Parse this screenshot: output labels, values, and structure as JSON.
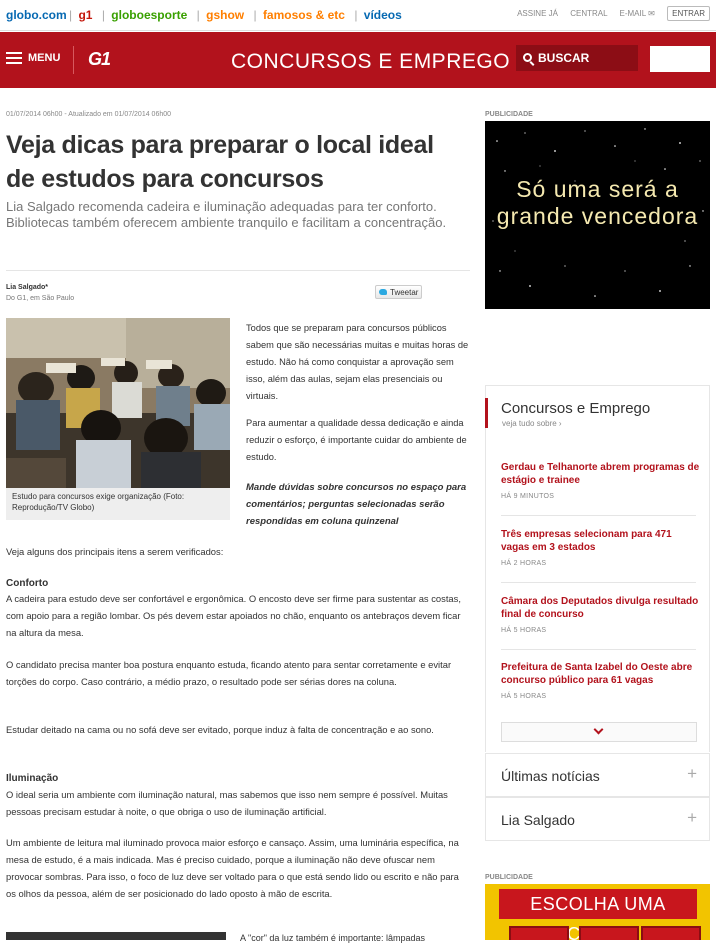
{
  "topbar": {
    "logo": "globo.com",
    "sites": [
      {
        "label": "g1",
        "color": "#c4170c"
      },
      {
        "label": "globoesporte",
        "color": "#39a000"
      },
      {
        "label": "gshow",
        "color": "#ff7f00"
      },
      {
        "label": "famosos & etc",
        "color": "#ff7f00"
      },
      {
        "label": "vídeos",
        "color": "#0669b2"
      }
    ],
    "assine": "ASSINE JÁ",
    "central": "CENTRAL",
    "email": "E-MAIL",
    "entrar": "ENTRAR"
  },
  "header": {
    "menu_label": "MENU",
    "logo": "G1",
    "section_title": "CONCURSOS E EMPREGO",
    "search_label": "BUSCAR"
  },
  "article": {
    "date": "01/07/2014 06h00 - Atualizado em 01/07/2014 06h00",
    "headline": "Veja dicas para preparar o local ideal de estudos para concursos",
    "subhead": "Lia Salgado recomenda cadeira e iluminação adequadas para ter conforto. Bibliotecas também oferecem ambiente tranquilo e facilitam a concentração.",
    "author": "Lia Salgado*",
    "author_location": "Do G1, em São Paulo",
    "tweet_label": "Tweetar",
    "photo_caption": "Estudo para concursos exige organização (Foto: Reprodução/TV Globo)",
    "intro_p1": "Todos que se preparam para concursos públicos sabem que são necessárias muitas e muitas horas de estudo. Não há como conquistar a aprovação sem isso, além das aulas, sejam elas presenciais ou virtuais.",
    "intro_p2": "Para aumentar a qualidade dessa dedicação e ainda reduzir o esforço, é importante cuidar do ambiente de estudo.",
    "intro_p3": "Mande dúvidas sobre concursos no espaço para comentários; perguntas selecionadas serão respondidas em coluna quinzenal",
    "body_1": "Veja alguns dos principais itens a serem verificados:",
    "heading_conforto": "Conforto",
    "body_2": "A cadeira para estudo deve ser confortável e ergonômica. O encosto deve ser firme para sustentar as costas, com apoio para a região lombar. Os pés devem estar apoiados no chão, enquanto os antebraços devem ficar na altura da mesa.",
    "body_3": "O candidato precisa manter boa postura enquanto estuda, ficando atento para sentar corretamente e evitar torções do corpo. Caso contrário, a médio prazo, o resultado pode ser sérias dores na coluna.",
    "body_4": "Estudar deitado na cama ou no sofá deve ser evitado, porque induz à falta de concentração e ao sono.",
    "heading_iluminacao": "Iluminação",
    "body_5": "O ideal seria um ambiente com iluminação natural, mas sabemos que isso nem sempre é possível. Muitas pessoas precisam estudar à noite, o que obriga o uso de iluminação artificial.",
    "body_6": "Um ambiente de leitura mal iluminado provoca maior esforço e cansaço. Assim, uma luminária específica, na mesa de estudo, é a mais indicada. Mas é preciso cuidado, porque a iluminação não deve ofuscar nem provocar sombras. Para isso, o foco de luz deve ser voltado para o que está sendo lido ou escrito e não para os olhos da pessoa, além de ser posicionado do lado oposto à mão de escrita.",
    "body_7": "A \"cor\" da luz também é importante: lâmpadas"
  },
  "sidebar": {
    "pub_label": "PUBLICIDADE",
    "ad1_text": "Só uma será a grande vencedora",
    "box_title": "Concursos e Emprego",
    "box_sub": "veja tudo sobre ›",
    "news": [
      {
        "title": "Gerdau e Telhanorte abrem programas de estágio e trainee",
        "time": "HÁ 9 MINUTOS"
      },
      {
        "title": "Três empresas selecionam para 471 vagas em 3 estados",
        "time": "HÁ 2 HORAS"
      },
      {
        "title": "Câmara dos Deputados divulga resultado final de concurso",
        "time": "HÁ 5 HORAS"
      },
      {
        "title": "Prefeitura de Santa Izabel do Oeste abre concurso público para 61 vagas",
        "time": "HÁ 5 HORAS"
      }
    ],
    "acc1": "Últimas notícias",
    "acc2": "Lia Salgado",
    "pub_label2": "PUBLICIDADE",
    "ad2_text": "ESCOLHA UMA CARTA"
  }
}
